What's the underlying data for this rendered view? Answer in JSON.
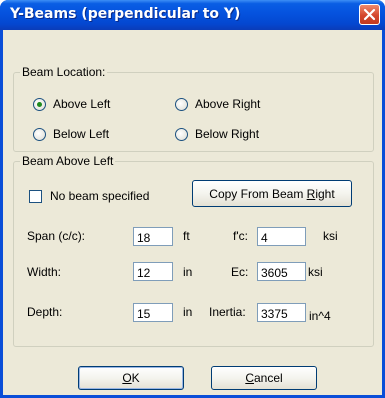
{
  "window": {
    "title": "Y-Beams (perpendicular to Y)",
    "close_icon": "close-icon"
  },
  "beam_location": {
    "legend": "Beam Location:",
    "options": [
      {
        "label": "Above Left",
        "selected": true
      },
      {
        "label": "Above Right",
        "selected": false
      },
      {
        "label": "Below Left",
        "selected": false
      },
      {
        "label": "Below Right",
        "selected": false
      }
    ]
  },
  "beam_section": {
    "legend": "Beam Above Left",
    "no_beam_label": "No beam specified",
    "no_beam_checked": false,
    "copy_button": {
      "prefix": "Copy From Beam ",
      "accel": "R",
      "suffix": "ight"
    },
    "span": {
      "label": "Span (c/c):",
      "value": "18",
      "unit": "ft"
    },
    "width": {
      "label": "Width:",
      "value": "12",
      "unit": "in"
    },
    "depth": {
      "label": "Depth:",
      "value": "15",
      "unit": "in"
    },
    "fc": {
      "label": "f'c:",
      "value": "4",
      "unit": "ksi"
    },
    "ec": {
      "label": "Ec:",
      "value": "3605",
      "unit": "ksi"
    },
    "inertia": {
      "label": "Inertia:",
      "value": "3375",
      "unit": "in^4"
    }
  },
  "buttons": {
    "ok": {
      "accel": "O",
      "rest": "K"
    },
    "cancel": {
      "accel": "C",
      "rest": "ancel"
    }
  },
  "colors": {
    "titlebar": "#0552de",
    "dialog_bg": "#ece9d8",
    "close_button": "#d4462c"
  }
}
